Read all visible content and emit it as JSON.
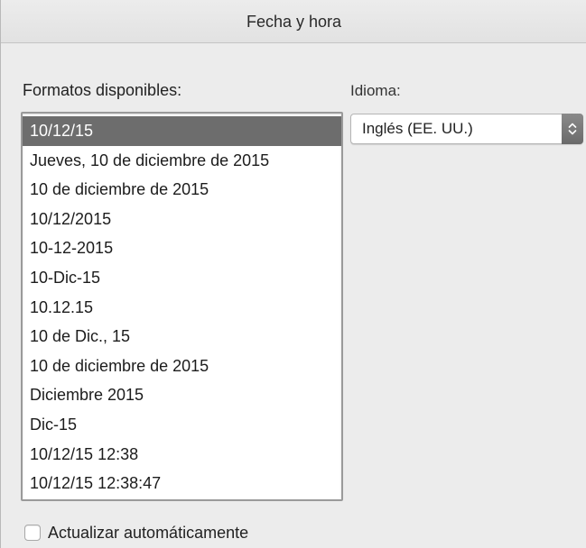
{
  "window": {
    "title": "Fecha y hora"
  },
  "formats": {
    "label": "Formatos disponibles:",
    "selected_index": 0,
    "items": [
      "10/12/15",
      "Jueves, 10 de diciembre de 2015",
      "10 de diciembre de 2015",
      "10/12/2015",
      "10-12-2015",
      "10-Dic-15",
      "10.12.15",
      "10 de Dic., 15",
      "10 de diciembre de 2015",
      "Diciembre 2015",
      "Dic-15",
      "10/12/15 12:38",
      "10/12/15 12:38:47"
    ]
  },
  "language": {
    "label": "Idioma:",
    "value": "Inglés (EE. UU.)",
    "icon": "updown-chevron-icon"
  },
  "auto_update": {
    "label": "Actualizar automáticamente",
    "checked": false
  },
  "colors": {
    "selection": "#6d6d6d",
    "background": "#ececec"
  }
}
